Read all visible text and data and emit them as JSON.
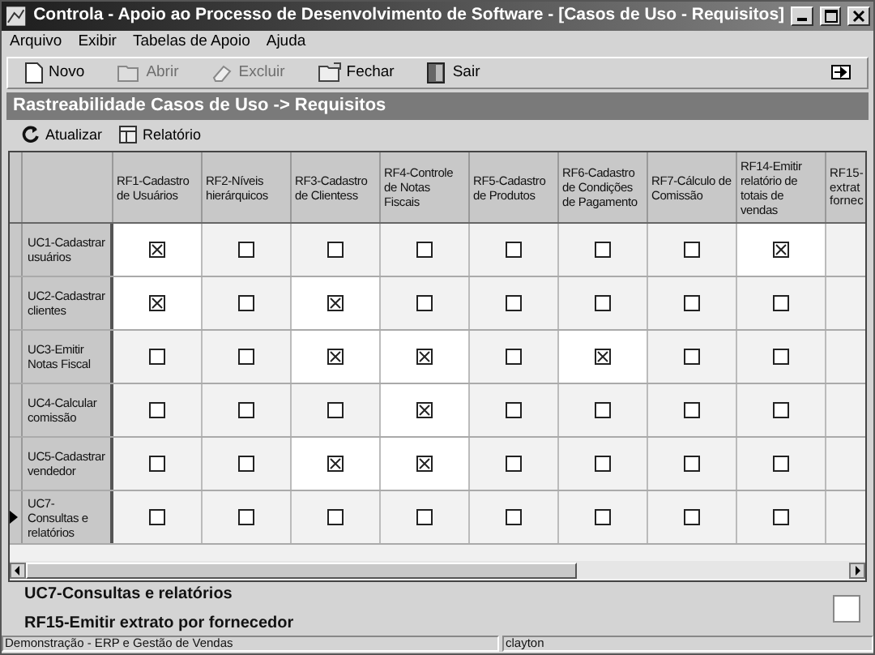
{
  "window": {
    "title": "Controla - Apoio ao Processo de Desenvolvimento de Software - [Casos de Uso - Requisitos]"
  },
  "menu": [
    "Arquivo",
    "Exibir",
    "Tabelas de Apoio",
    "Ajuda"
  ],
  "toolbar": [
    {
      "label": "Novo",
      "kind": "new",
      "disabled": false
    },
    {
      "label": "Abrir",
      "kind": "open",
      "disabled": true
    },
    {
      "label": "Excluir",
      "kind": "delete",
      "disabled": true
    },
    {
      "label": "Fechar",
      "kind": "close",
      "disabled": false
    },
    {
      "label": "Sair",
      "kind": "exit",
      "disabled": false
    }
  ],
  "panel_title": "Rastreabilidade Casos de Uso -> Requisitos",
  "panel_toolbar": [
    {
      "label": "Atualizar",
      "kind": "refresh"
    },
    {
      "label": "Relatório",
      "kind": "report"
    }
  ],
  "table": {
    "columns": [
      "RF1-Cadastro de Usuários",
      "RF2-Níveis hierárquicos",
      "RF3-Cadastro de Clientess",
      "RF4-Controle de Notas Fiscais",
      "RF5-Cadastro de Produtos",
      "RF6-Cadastro de Condições de Pagamento",
      "RF7-Cálculo de Comissão",
      "RF14-Emitir relatório de totais de vendas",
      "RF15-\nextrat\nfornec"
    ],
    "rows": [
      {
        "label": "UC1-Cadastrar usuários",
        "selected": false,
        "checked": [
          true,
          false,
          false,
          false,
          false,
          false,
          false,
          true
        ]
      },
      {
        "label": "UC2-Cadastrar clientes",
        "selected": false,
        "checked": [
          true,
          false,
          true,
          false,
          false,
          false,
          false,
          false
        ]
      },
      {
        "label": "UC3-Emitir Notas Fiscal",
        "selected": false,
        "checked": [
          false,
          false,
          true,
          true,
          false,
          true,
          false,
          false
        ]
      },
      {
        "label": "UC4-Calcular comissão",
        "selected": false,
        "checked": [
          false,
          false,
          false,
          true,
          false,
          false,
          false,
          false
        ]
      },
      {
        "label": "UC5-Cadastrar vendedor",
        "selected": false,
        "checked": [
          false,
          false,
          true,
          true,
          false,
          false,
          false,
          false
        ]
      },
      {
        "label": "UC7-Consultas e relatórios",
        "selected": true,
        "checked": [
          false,
          false,
          false,
          false,
          false,
          false,
          false,
          false
        ]
      }
    ]
  },
  "details": [
    "UC7-Consultas e relatórios",
    "RF15-Emitir extrato por fornecedor"
  ],
  "status_bar": [
    "Demonstração - ERP e Gestão de Vendas",
    "clayton"
  ]
}
